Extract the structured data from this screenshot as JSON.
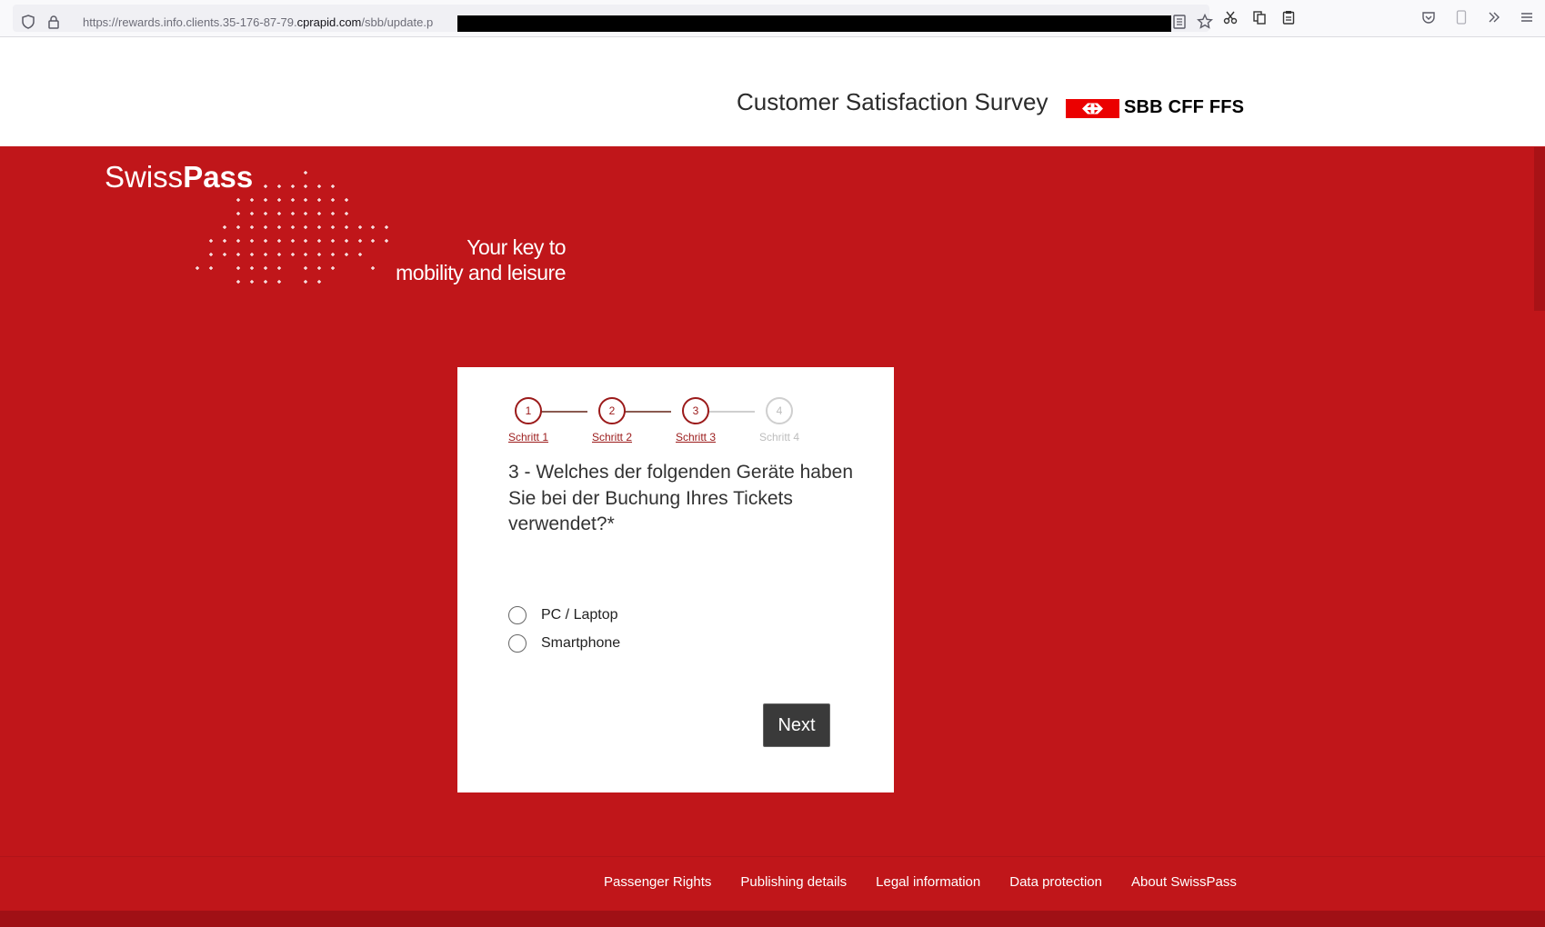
{
  "browser": {
    "url_prefix": "https://rewards.info.clients.35-176-87-79.",
    "url_domain": "cprapid.com",
    "url_path": "/sbb/update.p"
  },
  "header": {
    "survey_title": "Customer Satisfaction Survey",
    "sbb_logo_text": "SBB CFF FFS"
  },
  "hero": {
    "brand_light": "Swiss",
    "brand_bold": "Pass",
    "tagline_line1": "Your key to",
    "tagline_line2": "mobility and leisure"
  },
  "stepper": {
    "steps": [
      {
        "number": "1",
        "label": "Schritt 1",
        "state": "done"
      },
      {
        "number": "2",
        "label": "Schritt 2",
        "state": "done"
      },
      {
        "number": "3",
        "label": "Schritt 3",
        "state": "current"
      },
      {
        "number": "4",
        "label": "Schritt 4",
        "state": "todo"
      }
    ]
  },
  "question": {
    "text": "3 - Welches der folgenden Geräte haben Sie bei der Buchung Ihres Tickets verwendet?*",
    "options": [
      "PC / Laptop",
      "Smartphone"
    ]
  },
  "actions": {
    "next_label": "Next"
  },
  "footer": {
    "links": [
      "Passenger Rights",
      "Publishing details",
      "Legal information",
      "Data protection",
      "About SwissPass"
    ]
  },
  "colors": {
    "brand_red": "#c0161a",
    "sbb_red": "#eb0000",
    "button_dark": "#3a3a3a"
  }
}
